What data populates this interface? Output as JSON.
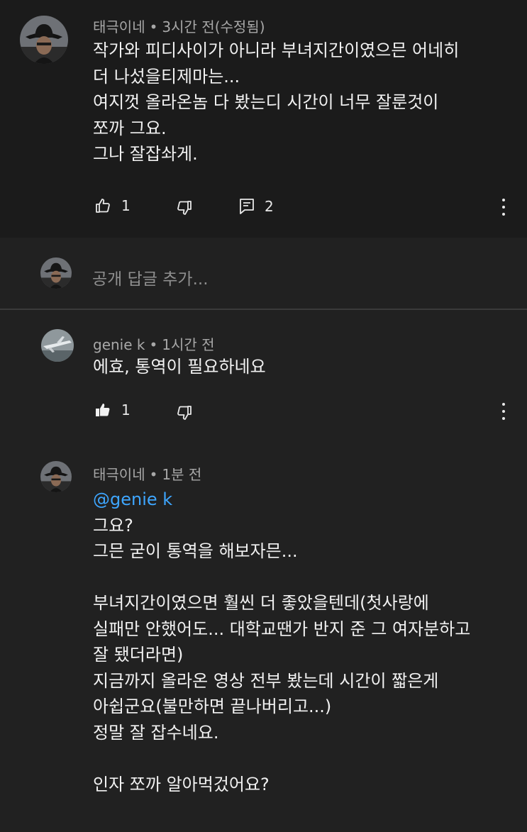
{
  "comment": {
    "author": "태극이네",
    "time": "3시간 전(수정됨)",
    "lines": [
      "작가와 피디사이가 아니라 부녀지간이였으믄 어네히",
      "더 나섰을티제마는...",
      "여지껏 올라온놈 다 봤는디 시간이 너무 잘룬것이",
      "쪼까 그요.",
      "그나 잘잡솨게."
    ],
    "like_count": "1",
    "reply_count": "2",
    "icons": {
      "like": "thumb-up-icon",
      "dislike": "thumb-down-icon",
      "replies": "reply-comment-icon",
      "more": "more-vert-icon"
    }
  },
  "reply_box": {
    "placeholder": "공개 답글 추가..."
  },
  "replies": [
    {
      "author": "genie k",
      "time": "1시간 전",
      "lines": [
        "에효, 통역이 필요하네요"
      ],
      "like_count": "1",
      "liked": true
    },
    {
      "author": "태극이네",
      "time": "1분 전",
      "mention": "@genie k",
      "lines": [
        "그요?",
        "그믄 굳이 통역을 해보자믄...",
        "",
        "부녀지간이였으면 훨씬 더 좋았을텐데(첫사랑에",
        "실패만 안했어도... 대학교땐가 반지 준 그 여자분하고",
        "잘 됐더라면)",
        "지금까지 올라온 영상 전부 봤는데 시간이 짧은게",
        "아쉽군요(불만하면 끝나버리고...)",
        "정말 잘 잡수네요.",
        "",
        "인자 쪼까 알아먹겄어요?"
      ]
    }
  ],
  "meta_separator": "•",
  "colors": {
    "top_bg": "#1b1b1b",
    "page_bg": "#212121",
    "divider": "#3a3a3a",
    "text": "#f1f1f1",
    "meta": "#a8a8a8",
    "mention": "#3ea6ff"
  }
}
